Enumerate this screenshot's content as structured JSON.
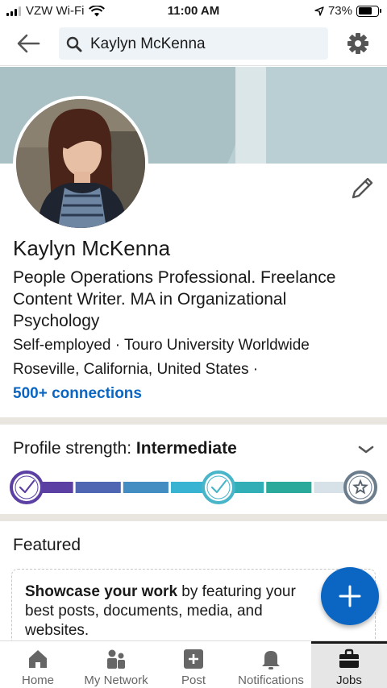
{
  "status_bar": {
    "carrier": "VZW Wi-Fi",
    "time": "11:00 AM",
    "battery": "73%",
    "battery_level": 0.73,
    "icons": [
      "signal-icon",
      "wifi-icon",
      "location-arrow-icon",
      "battery-icon"
    ]
  },
  "topnav": {
    "search_value": "Kaylyn McKenna",
    "icons": [
      "back-arrow-icon",
      "search-icon",
      "gear-icon"
    ]
  },
  "profile": {
    "name": "Kaylyn McKenna",
    "headline": "People Operations Professional. Freelance Content Writer. MA in Organizational Psychology",
    "companies": "Self-employed · Touro University Worldwide",
    "location": "Roseville, California, United States ·",
    "connections": "500+ connections",
    "edit_icon": "pencil-icon"
  },
  "profile_strength": {
    "label": "Profile strength: ",
    "level": "Intermediate",
    "chevron_icon": "chevron-down-icon",
    "segments_filled": 6,
    "segments_total": 7
  },
  "featured": {
    "title": "Featured",
    "bold": "Showcase your work",
    "rest": " by featuring your best posts, documents, media, and websites."
  },
  "fab_icon": "plus-icon",
  "bottom_nav": [
    {
      "label": "Home",
      "icon": "home-icon",
      "active": false
    },
    {
      "label": "My Network",
      "icon": "network-icon",
      "active": false
    },
    {
      "label": "Post",
      "icon": "post-icon",
      "active": false
    },
    {
      "label": "Notifications",
      "icon": "bell-icon",
      "active": false
    },
    {
      "label": "Jobs",
      "icon": "briefcase-icon",
      "active": true
    }
  ],
  "colors": {
    "accent": "#0a66c2",
    "banner": "#bacfd3",
    "meter_purple": "#5b3fa3",
    "meter_teal": "#2ba99a",
    "search_bg": "#eef3f8"
  }
}
